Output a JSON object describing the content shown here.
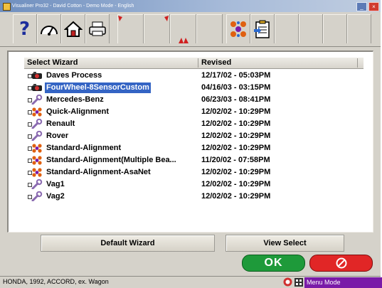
{
  "window": {
    "title": "Visualiner Pro32 - David Cotton - Demo Mode - English"
  },
  "titlebar": {
    "minimize_glyph": "_",
    "close_glyph": "×"
  },
  "toolbar": {
    "buttons": [
      {
        "id": "help",
        "label": "?",
        "icon": "help-icon"
      },
      {
        "id": "gauge",
        "icon": "gauge-icon"
      },
      {
        "id": "home",
        "icon": "home-icon"
      },
      {
        "id": "printer",
        "icon": "printer-icon"
      },
      {
        "id": "blank1",
        "icon": "red-marker-icon"
      },
      {
        "id": "blank2",
        "icon": "red-marker-icon"
      },
      {
        "id": "blank3",
        "icon": "red-marker-icon"
      },
      {
        "id": "wizard",
        "icon": "wizard-icon"
      },
      {
        "id": "clipboard",
        "icon": "clipboard-icon"
      }
    ]
  },
  "list": {
    "columns": [
      "Select Wizard",
      "Revised"
    ],
    "rows": [
      {
        "name": "Daves Process",
        "revised": "12/17/02 - 05:03PM",
        "icon": "camera-icon"
      },
      {
        "name": "FourWheel-8SensorCustom",
        "revised": "04/16/03 - 03:15PM",
        "icon": "camera-icon",
        "selected": true
      },
      {
        "name": "Mercedes-Benz",
        "revised": "06/23/03 - 08:41PM",
        "icon": "wrench-icon"
      },
      {
        "name": "Quick-Alignment",
        "revised": "12/02/02 - 10:29PM",
        "icon": "wizard-icon"
      },
      {
        "name": "Renault",
        "revised": "12/02/02 - 10:29PM",
        "icon": "wrench-icon"
      },
      {
        "name": "Rover",
        "revised": "12/02/02 - 10:29PM",
        "icon": "wrench-icon"
      },
      {
        "name": "Standard-Alignment",
        "revised": "12/02/02 - 10:29PM",
        "icon": "wizard-icon"
      },
      {
        "name": "Standard-Alignment(Multiple Bea...",
        "revised": "11/20/02 - 07:58PM",
        "icon": "wizard-icon"
      },
      {
        "name": "Standard-Alignment-AsaNet",
        "revised": "12/02/02 - 10:29PM",
        "icon": "wizard-icon"
      },
      {
        "name": "Vag1",
        "revised": "12/02/02 - 10:29PM",
        "icon": "wrench-icon"
      },
      {
        "name": "Vag2",
        "revised": "12/02/02 - 10:29PM",
        "icon": "wrench-icon"
      }
    ]
  },
  "actions": {
    "default_wizard": "Default Wizard",
    "view_select": "View Select",
    "ok": "OK",
    "cancel_icon": "no-entry-icon"
  },
  "status": {
    "vehicle": "HONDA, 1992, ACCORD, ex. Wagon",
    "mode": "Menu Mode"
  },
  "colors": {
    "selection": "#3464c4",
    "ok": "#1e9a3a",
    "cancel": "#e12626",
    "menu_mode": "#7a1aa8"
  }
}
